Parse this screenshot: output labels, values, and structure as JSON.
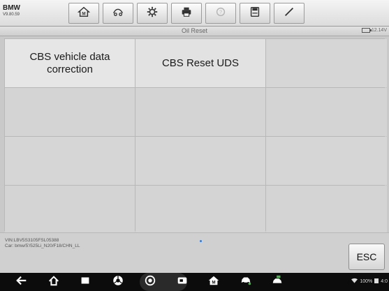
{
  "app": {
    "brand": "BMW",
    "version": "V9.80.59"
  },
  "toolbar": {
    "buttons": [
      {
        "name": "home-icon"
      },
      {
        "name": "car-lift-icon"
      },
      {
        "name": "gear-icon"
      },
      {
        "name": "printer-icon"
      },
      {
        "name": "help-icon"
      },
      {
        "name": "save-icon"
      },
      {
        "name": "pen-icon"
      }
    ]
  },
  "status": {
    "title": "Oil Reset",
    "battery_voltage": "12.14V"
  },
  "grid": {
    "cells": [
      {
        "label": "CBS vehicle data correction"
      },
      {
        "label": "CBS Reset UDS"
      },
      {
        "label": ""
      },
      {
        "label": ""
      },
      {
        "label": ""
      },
      {
        "label": ""
      },
      {
        "label": ""
      },
      {
        "label": ""
      },
      {
        "label": ""
      },
      {
        "label": ""
      },
      {
        "label": ""
      },
      {
        "label": ""
      }
    ]
  },
  "footer": {
    "vin": "VIN:LBV5S3105FSL05388",
    "car": "Car: bmw/5'/525Li_N20/F18/CHN_LL",
    "esc_label": "ESC"
  },
  "navbar": {
    "items": [
      "back-icon",
      "home-icon",
      "recents-icon",
      "chrome-icon",
      "camera-icon",
      "screenshot-icon",
      "autel-home-icon",
      "car-icon",
      "car-connect-icon"
    ],
    "tray": "100%",
    "time": "4:0"
  },
  "colors": {
    "accent": "#2f7de0",
    "toolbar_bg": "#e8e8e8",
    "navbar_bg": "#0c0c0c"
  }
}
